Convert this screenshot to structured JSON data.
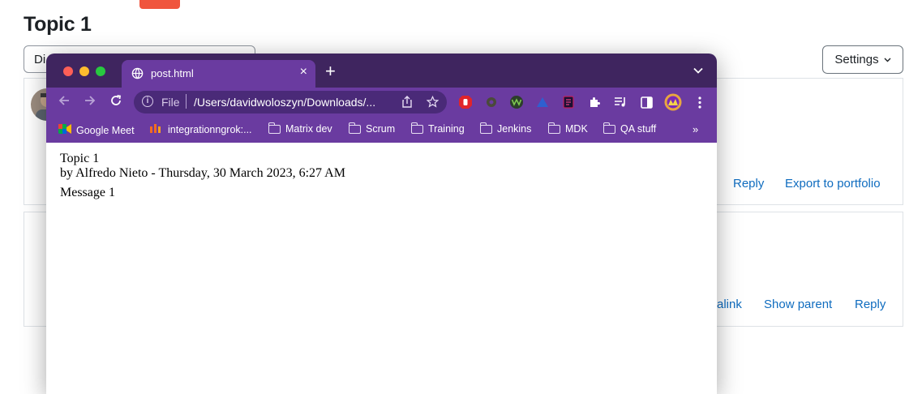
{
  "page": {
    "title": "Topic 1",
    "display_select_value": "Di",
    "settings_label": "Settings",
    "post1_links": {
      "reply": "Reply",
      "export": "Export to portfolio"
    },
    "post2_links": {
      "permalink_partial": "alink",
      "show_parent": "Show parent",
      "reply": "Reply"
    }
  },
  "browser": {
    "tab_title": "post.html",
    "tab_close": "×",
    "new_tab": "+",
    "url_scheme": "File",
    "url": "/Users/davidwoloszyn/Downloads/...",
    "bookmarks": [
      {
        "label": "Google Meet",
        "icon": "google-meet-icon"
      },
      {
        "label": "integrationngrok:...",
        "icon": "ngrok-icon"
      },
      {
        "label": "Matrix dev",
        "icon": "folder-icon"
      },
      {
        "label": "Scrum",
        "icon": "folder-icon"
      },
      {
        "label": "Training",
        "icon": "folder-icon"
      },
      {
        "label": "Jenkins",
        "icon": "folder-icon"
      },
      {
        "label": "MDK",
        "icon": "folder-icon"
      },
      {
        "label": "QA stuff",
        "icon": "folder-icon"
      }
    ],
    "bookmarks_more": "»"
  },
  "document": {
    "heading": "Topic 1",
    "byline": "by Alfredo Nieto - Thursday, 30 March 2023, 6:27 AM",
    "message": "Message 1"
  },
  "colors": {
    "tabstrip": "#3f255f",
    "toolbar": "#6a3ba0",
    "link": "#0f6cbf",
    "accent_red": "#f0553d"
  }
}
